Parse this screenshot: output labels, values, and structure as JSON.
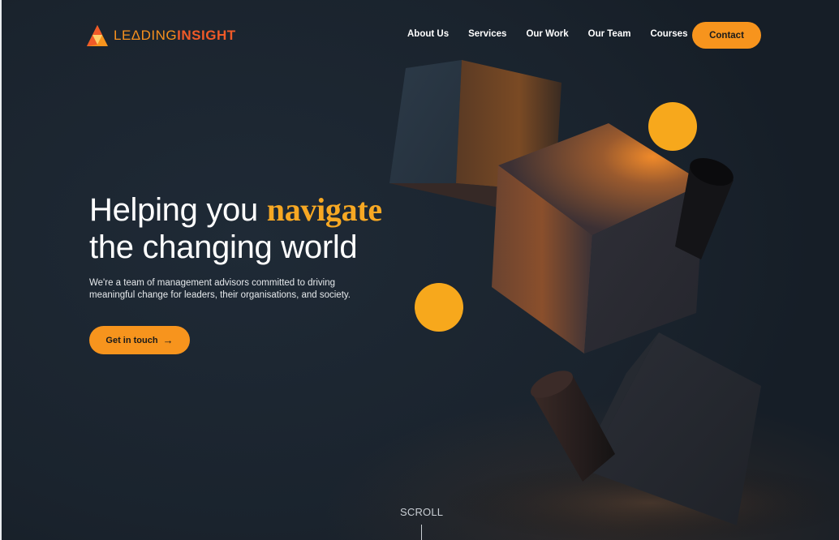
{
  "brand": {
    "name_part1": "LEΔDING",
    "name_part2": "INSIGHT",
    "colors": {
      "orange": "#f7941d",
      "red_orange": "#f05a28",
      "yellow": "#f7a823",
      "background": "#1c2631"
    }
  },
  "nav": {
    "items": [
      "About Us",
      "Services",
      "Our Work",
      "Our Team",
      "Courses"
    ],
    "contact_label": "Contact"
  },
  "hero": {
    "title_part1": "Helping you ",
    "title_accent": "navigate",
    "title_part2": "the changing world",
    "subtitle": "We're a team of management advisors committed to driving meaningful change for leaders, their organisations, and society.",
    "cta_label": "Get in touch",
    "cta_icon": "arrow-right-icon"
  },
  "scroll": {
    "label": "SCROLL"
  }
}
